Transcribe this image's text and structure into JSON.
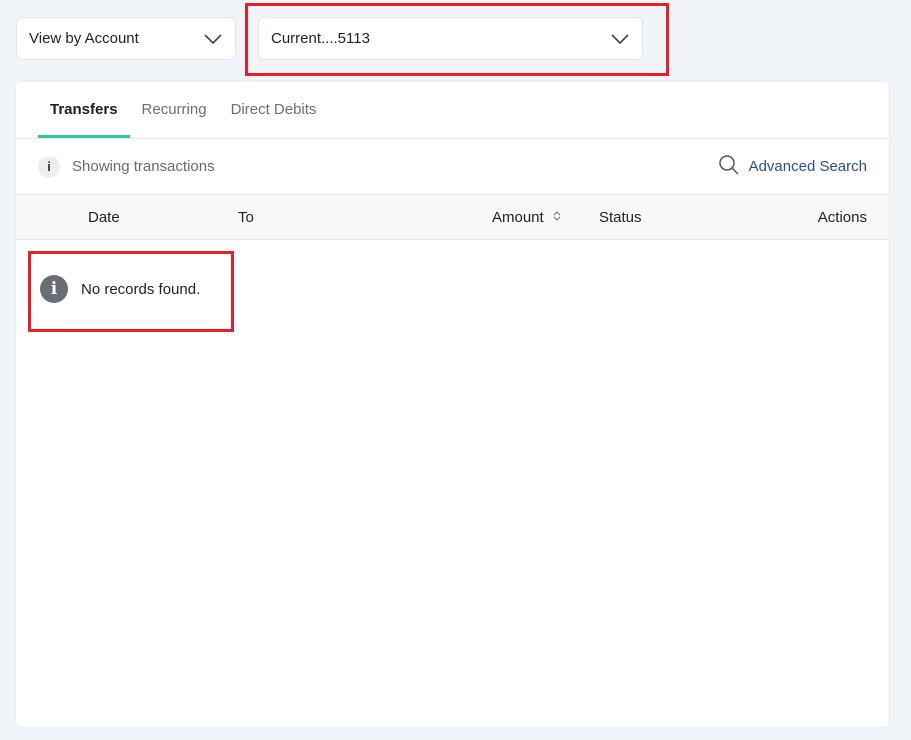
{
  "filters": {
    "view_select": {
      "value": "View by Account"
    },
    "account_select": {
      "value": "Current....5113"
    }
  },
  "tabs": [
    {
      "label": "Transfers",
      "active": true
    },
    {
      "label": "Recurring",
      "active": false
    },
    {
      "label": "Direct Debits",
      "active": false
    }
  ],
  "infobar": {
    "message": "Showing transactions",
    "info_icon_glyph": "i",
    "advanced_search_label": "Advanced Search"
  },
  "table": {
    "columns": [
      "Date",
      "To",
      "Amount",
      "Status",
      "Actions"
    ],
    "empty_message": "No records found.",
    "empty_icon_glyph": "i"
  },
  "colors": {
    "active_tab_underline": "#34c6a0",
    "link": "#2c4f8f",
    "highlight_box": "#e3202b"
  },
  "icons": [
    "chevron-down-icon",
    "info-icon",
    "search-icon",
    "sort-icon"
  ]
}
